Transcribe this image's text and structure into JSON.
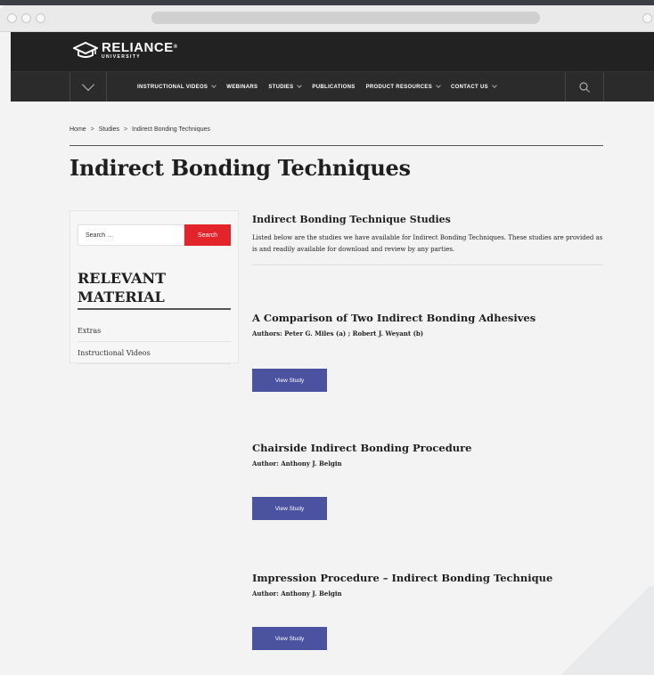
{
  "brand": {
    "name": "RELIANCE",
    "registered": "®",
    "sub": "UNIVERSITY"
  },
  "nav": {
    "items": [
      {
        "label": "INSTRUCTIONAL VIDEOS",
        "dropdown": true
      },
      {
        "label": "WEBINARS",
        "dropdown": false
      },
      {
        "label": "STUDIES",
        "dropdown": true
      },
      {
        "label": "PUBLICATIONS",
        "dropdown": false
      },
      {
        "label": "PRODUCT RESOURCES",
        "dropdown": true
      },
      {
        "label": "CONTACT US",
        "dropdown": true
      }
    ]
  },
  "breadcrumb": {
    "home": "Home",
    "sep1": ">",
    "studies": "Studies",
    "sep2": ">",
    "current": "Indirect Bonding Techniques"
  },
  "page": {
    "title": "Indirect Bonding Techniques"
  },
  "sidebar": {
    "search_placeholder": "Search …",
    "search_button": "Search",
    "heading": "RELEVANT MATERIAL",
    "items": [
      "Extras",
      "Instructional Videos"
    ]
  },
  "main": {
    "heading": "Indirect Bonding Technique Studies",
    "description": "Listed below are the studies we have available for Indirect Bonding Techniques. These studies are provided as is and readily available for download and review by any parties."
  },
  "studies": [
    {
      "title": "A Comparison of Two Indirect Bonding Adhesives",
      "authors": "Authors: Peter G. Miles (a) ; Robert J. Weyant (b)",
      "button": "View Study"
    },
    {
      "title": "Chairside Indirect Bonding Procedure",
      "authors": "Author: Anthony J. Belgin",
      "button": "View Study"
    },
    {
      "title": "Impression Procedure – Indirect Bonding Technique",
      "authors": "Author: Anthony J. Belgin",
      "button": "View Study"
    }
  ],
  "colors": {
    "accent_red": "#e3242b",
    "button_blue": "#4b52a0",
    "header_dark": "#222222"
  }
}
